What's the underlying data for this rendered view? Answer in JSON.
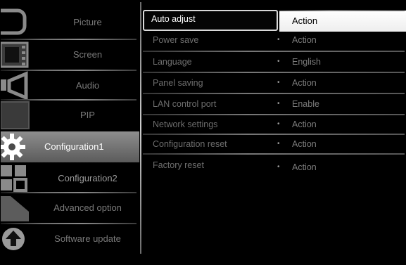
{
  "sidebar": {
    "items": [
      {
        "label": "Picture"
      },
      {
        "label": "Screen"
      },
      {
        "label": "Audio"
      },
      {
        "label": "PIP"
      },
      {
        "label": "Configuration1"
      },
      {
        "label": "Configuration2"
      },
      {
        "label": "Advanced option"
      },
      {
        "label": "Software update"
      }
    ],
    "active_index": 4
  },
  "settings": {
    "rows": [
      {
        "name": "Auto adjust",
        "value": "Action"
      },
      {
        "name": "Power save",
        "value": "Action"
      },
      {
        "name": "Language",
        "value": "English"
      },
      {
        "name": "Panel saving",
        "value": "Action"
      },
      {
        "name": "LAN control port",
        "value": "Enable"
      },
      {
        "name": "Network settings",
        "value": "Action"
      },
      {
        "name": "Configuration reset",
        "value": "Action"
      },
      {
        "name": "Factory reset",
        "value": "Action"
      }
    ],
    "selected_index": 0
  },
  "icons": {
    "picture": "monitor-icon",
    "screen": "filmstrip-icon",
    "audio": "speaker-icon",
    "pip": "pip-icon",
    "configuration1": "gear-icon",
    "configuration2": "grid-config-icon",
    "advanced": "advanced-option-icon",
    "software_update": "upload-arrow-icon"
  },
  "colors": {
    "background": "#000000",
    "active_tab": "#7a7a7a",
    "selected_value_bg": "#ffffff",
    "dim_text": "#6e6e6e"
  }
}
